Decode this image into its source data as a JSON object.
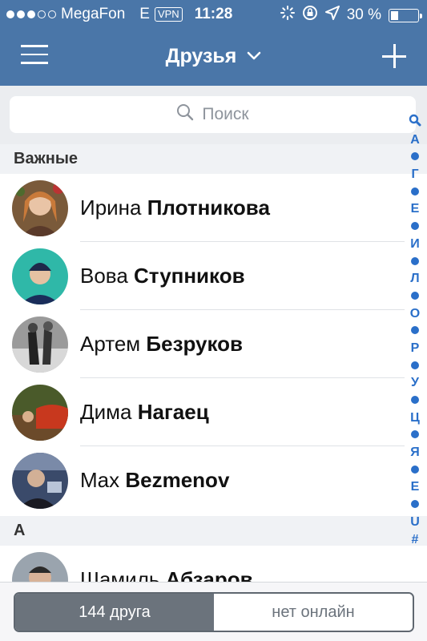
{
  "status_bar": {
    "carrier": "MegaFon",
    "network": "E",
    "vpn": "VPN",
    "time": "11:28",
    "battery_percent": "30 %",
    "battery_level": 0.3
  },
  "nav": {
    "title": "Друзья",
    "menu_icon": "hamburger-menu-icon",
    "add_icon": "plus-icon"
  },
  "search": {
    "placeholder": "Поиск"
  },
  "sections": [
    {
      "title": "Важные",
      "friends": [
        {
          "first": "Ирина",
          "last": "Плотникова"
        },
        {
          "first": "Вова",
          "last": "Ступников"
        },
        {
          "first": "Артем",
          "last": "Безруков"
        },
        {
          "first": "Дима",
          "last": "Нагаец"
        },
        {
          "first": "Max",
          "last": "Bezmenov"
        }
      ]
    },
    {
      "title": "А",
      "friends": [
        {
          "first": "Шамиль",
          "last": "Абзаров"
        }
      ]
    }
  ],
  "index_bar": [
    "search",
    "А",
    "•",
    "Г",
    "•",
    "Е",
    "•",
    "И",
    "•",
    "Л",
    "•",
    "О",
    "•",
    "Р",
    "•",
    "У",
    "•",
    "Ц",
    "•",
    "Я",
    "•",
    "E",
    "•",
    "U",
    "#"
  ],
  "bottom_tabs": {
    "friends_count": "144 друга",
    "online": "нет онлайн"
  },
  "colors": {
    "header": "#4a76a8",
    "index_accent": "#2a6fc9",
    "segment_active": "#6b737c"
  }
}
